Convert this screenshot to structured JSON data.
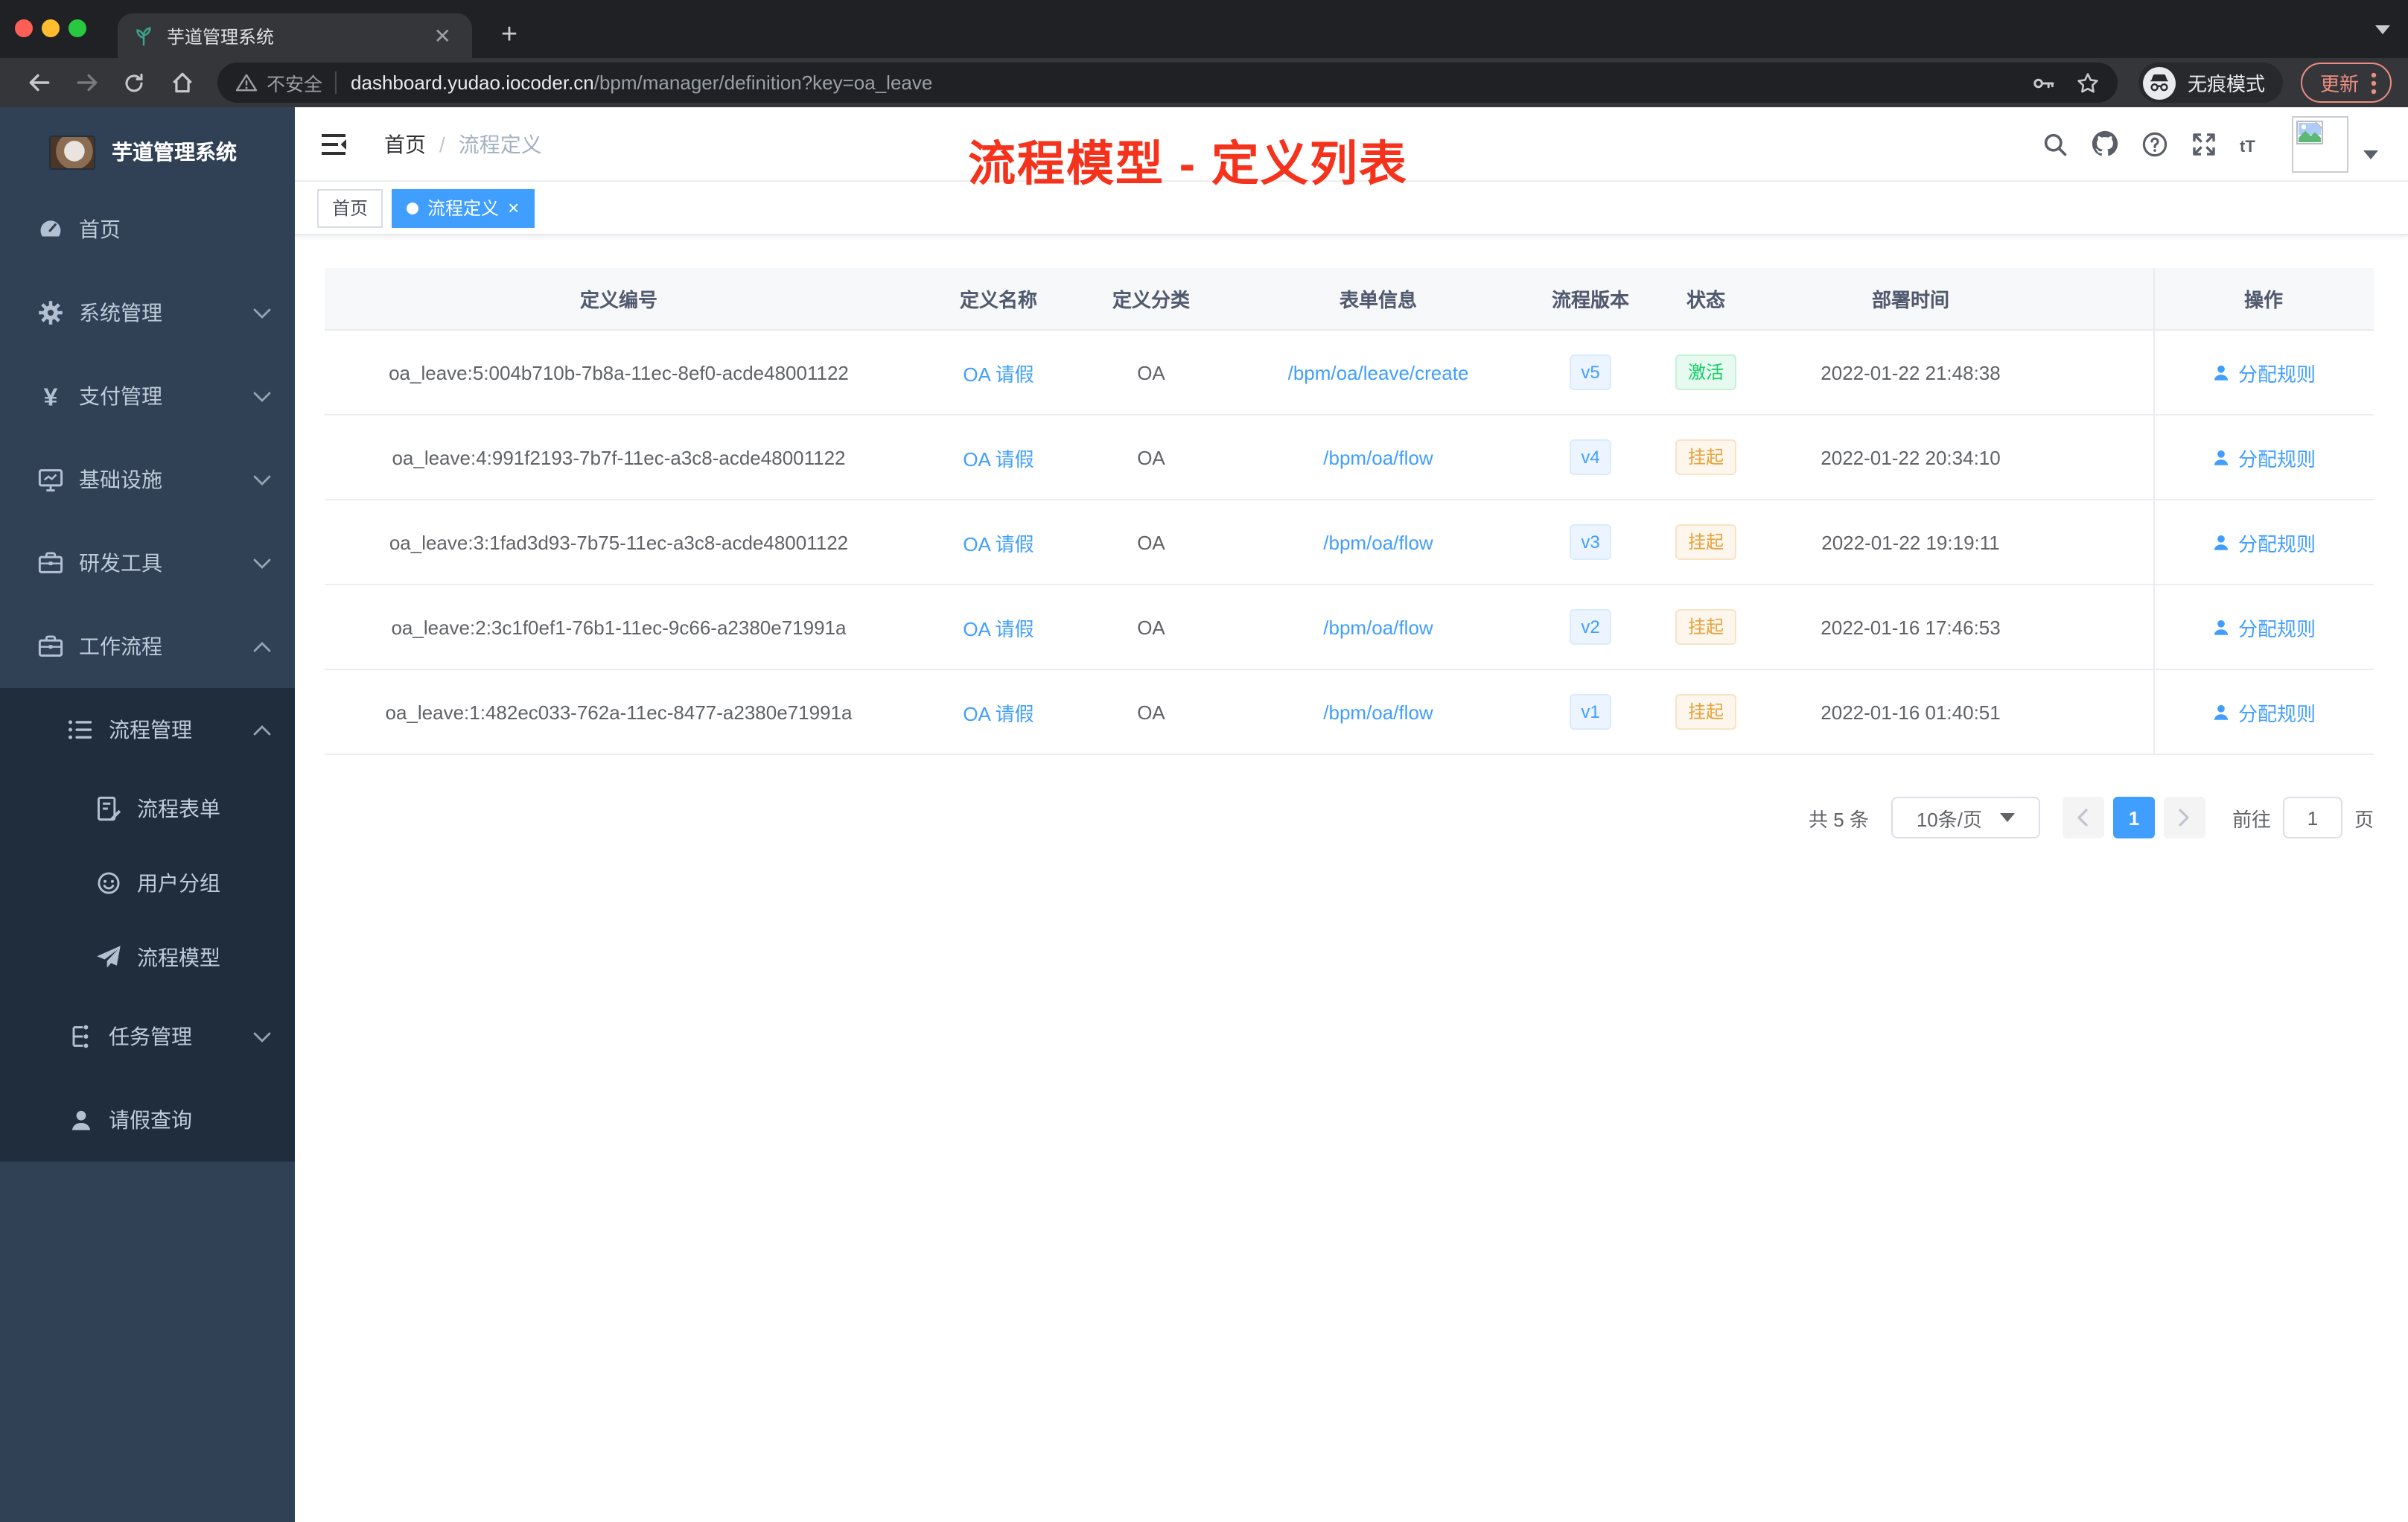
{
  "browser": {
    "tab_title": "芋道管理系统",
    "new_tab_label": "+",
    "security_label": "不安全",
    "url_host": "dashboard.yudao.iocoder.cn",
    "url_path": "/bpm/manager/definition?key=oa_leave",
    "incognito_label": "无痕模式",
    "update_label": "更新"
  },
  "sidebar": {
    "app_title": "芋道管理系统",
    "menu": [
      {
        "label": "首页",
        "icon": "dashboard-icon",
        "level": 1,
        "chevron": "",
        "dark": false
      },
      {
        "label": "系统管理",
        "icon": "gear-icon",
        "level": 1,
        "chevron": "down",
        "dark": false
      },
      {
        "label": "支付管理",
        "icon": "yen-icon",
        "level": 1,
        "chevron": "down",
        "dark": false
      },
      {
        "label": "基础设施",
        "icon": "monitor-icon",
        "level": 1,
        "chevron": "down",
        "dark": false
      },
      {
        "label": "研发工具",
        "icon": "toolbox-icon",
        "level": 1,
        "chevron": "down",
        "dark": false
      },
      {
        "label": "工作流程",
        "icon": "briefcase-icon",
        "level": 1,
        "chevron": "up",
        "dark": false
      },
      {
        "label": "流程管理",
        "icon": "list-icon",
        "level": 2,
        "chevron": "up",
        "dark": true
      },
      {
        "label": "流程表单",
        "icon": "form-icon",
        "level": 3,
        "chevron": "",
        "dark": true
      },
      {
        "label": "用户分组",
        "icon": "face-icon",
        "level": 3,
        "chevron": "",
        "dark": true
      },
      {
        "label": "流程模型",
        "icon": "send-icon",
        "level": 3,
        "chevron": "",
        "dark": true
      },
      {
        "label": "任务管理",
        "icon": "tree-icon",
        "level": 2,
        "chevron": "down",
        "dark": true
      },
      {
        "label": "请假查询",
        "icon": "user-icon",
        "level": 2,
        "chevron": "",
        "dark": true
      }
    ]
  },
  "header": {
    "breadcrumb_home": "首页",
    "breadcrumb_separator": "/",
    "breadcrumb_current": "流程定义",
    "overlay_title": "流程模型 - 定义列表"
  },
  "tags": [
    {
      "label": "首页",
      "active": false
    },
    {
      "label": "流程定义",
      "active": true
    }
  ],
  "table": {
    "columns": [
      "定义编号",
      "定义名称",
      "定义分类",
      "表单信息",
      "流程版本",
      "状态",
      "部署时间",
      "操作"
    ],
    "action_label": "分配规则",
    "rows": [
      {
        "id": "oa_leave:5:004b710b-7b8a-11ec-8ef0-acde48001122",
        "name": "OA 请假",
        "category": "OA",
        "form": "/bpm/oa/leave/create",
        "version": "v5",
        "status": "激活",
        "status_type": "active",
        "deployed": "2022-01-22 21:48:38"
      },
      {
        "id": "oa_leave:4:991f2193-7b7f-11ec-a3c8-acde48001122",
        "name": "OA 请假",
        "category": "OA",
        "form": "/bpm/oa/flow",
        "version": "v4",
        "status": "挂起",
        "status_type": "suspend",
        "deployed": "2022-01-22 20:34:10"
      },
      {
        "id": "oa_leave:3:1fad3d93-7b75-11ec-a3c8-acde48001122",
        "name": "OA 请假",
        "category": "OA",
        "form": "/bpm/oa/flow",
        "version": "v3",
        "status": "挂起",
        "status_type": "suspend",
        "deployed": "2022-01-22 19:19:11"
      },
      {
        "id": "oa_leave:2:3c1f0ef1-76b1-11ec-9c66-a2380e71991a",
        "name": "OA 请假",
        "category": "OA",
        "form": "/bpm/oa/flow",
        "version": "v2",
        "status": "挂起",
        "status_type": "suspend",
        "deployed": "2022-01-16 17:46:53"
      },
      {
        "id": "oa_leave:1:482ec033-762a-11ec-8477-a2380e71991a",
        "name": "OA 请假",
        "category": "OA",
        "form": "/bpm/oa/flow",
        "version": "v1",
        "status": "挂起",
        "status_type": "suspend",
        "deployed": "2022-01-16 01:40:51"
      }
    ]
  },
  "pagination": {
    "total_label": "共 5 条",
    "page_size_label": "10条/页",
    "current_page": "1",
    "goto_label": "前往",
    "goto_value": "1",
    "page_suffix": "页"
  },
  "colors": {
    "accent_blue": "#409eff",
    "sidebar_bg": "#304156",
    "sidebar_submenu_bg": "#1f2d3d",
    "status_active_green": "#13ce66",
    "status_suspend_yellow": "#e6a23c",
    "overlay_red": "#f5331d"
  }
}
